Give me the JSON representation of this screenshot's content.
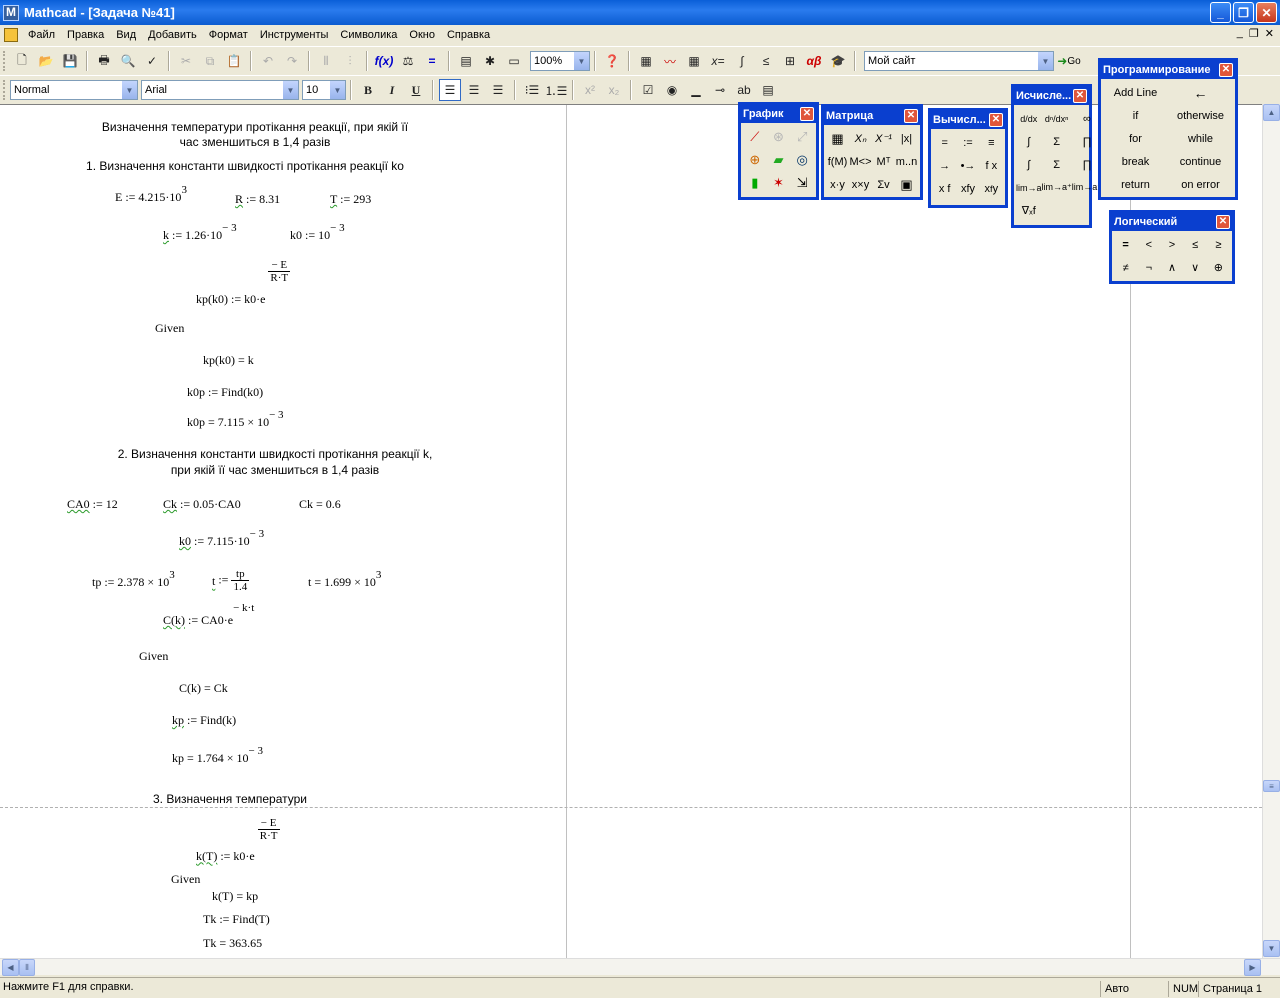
{
  "window": {
    "title": "Mathcad - [Задача №41]"
  },
  "menu": [
    "Файл",
    "Правка",
    "Вид",
    "Добавить",
    "Формат",
    "Инструменты",
    "Символика",
    "Окно",
    "Справка"
  ],
  "toolbar": {
    "zoom": "100%",
    "site": "Мой сайт",
    "go_label": "Go"
  },
  "format_bar": {
    "style": "Normal",
    "font": "Arial",
    "size": "10",
    "bold": "B",
    "italic": "I",
    "underline": "U"
  },
  "doc": {
    "title1": "Визначення температури протікання реакції, при якій її",
    "title2": "час зменшиться в 1,4 разів",
    "s1": "1. Визначення константи швидкості протікання реакції ko",
    "E_def": "E := 4.215·10",
    "E_exp": "3",
    "R_var": "R",
    "R_def": " := 8.31",
    "T_var": "T",
    "T_def": " := 293",
    "k_var": "k",
    "k_def": " := 1.26·10",
    "k_exp": "− 3",
    "k0_def": "k0 := 10",
    "k0_exp": "− 3",
    "kp_lhs": "kp(k0) := k0·e",
    "frac_num": "− E",
    "frac_den": "R·T",
    "given": "Given",
    "kp_eq": "kp(k0) = k",
    "k0p_find": "k0p := Find(k0)",
    "k0p_val": "k0p = 7.115 × 10",
    "k0p_exp": "− 3",
    "s2a": "2. Визначення константи швидкості протікання реакції k,",
    "s2b": "при якій її час зменшиться в 1,4 разів",
    "CA0_var": "CA0",
    "CA0_def": " := 12",
    "Ck_var": "Ck",
    "Ck_def": " := 0.05·CA0",
    "Ck_val": "Ck = 0.6",
    "k0b_var": "k0",
    "k0b_def": " := 7.115·10",
    "k0b_exp": "− 3",
    "tp_def": "tp := 2.378 × 10",
    "tp_exp": "3",
    "t_var": "t",
    "t_def": " := ",
    "t_num": "tp",
    "t_den": "1.4",
    "t_val": "t = 1.699 × 10",
    "t_val_exp": "3",
    "C_var": "C(k)",
    "C_def": " := CA0·e",
    "C_exp": "− k·t",
    "C_eq": "C(k) = Ck",
    "kp2_var": "kp",
    "kp2_def": " := Find(k)",
    "kp2_val": "kp = 1.764 × 10",
    "kp2_exp": "− 3",
    "s3": "3. Визначення температури",
    "kT_var": "k(T)",
    "kT_def": " := k0·e",
    "kT_eq": "k(T) = kp",
    "Tk_find": "Tk := Find(T)",
    "Tk_val": "Tk = 363.65"
  },
  "palettes": {
    "graph": {
      "title": "График"
    },
    "matrix": {
      "title": "Матрица"
    },
    "eval": {
      "title": "Вычисл..."
    },
    "calc": {
      "title": "Исчисле..."
    },
    "prog": {
      "title": "Программирование",
      "items": [
        "Add Line",
        "←",
        "if",
        "otherwise",
        "for",
        "while",
        "break",
        "continue",
        "return",
        "on error"
      ]
    },
    "logic": {
      "title": "Логический",
      "items": [
        "=",
        "<",
        ">",
        "≤",
        "≥",
        "≠",
        "¬",
        "∧",
        "∨",
        "⊕"
      ]
    }
  },
  "status": {
    "help": "Нажмите F1 для справки.",
    "mode": "Авто",
    "num": "NUM",
    "page": "Страница 1"
  }
}
